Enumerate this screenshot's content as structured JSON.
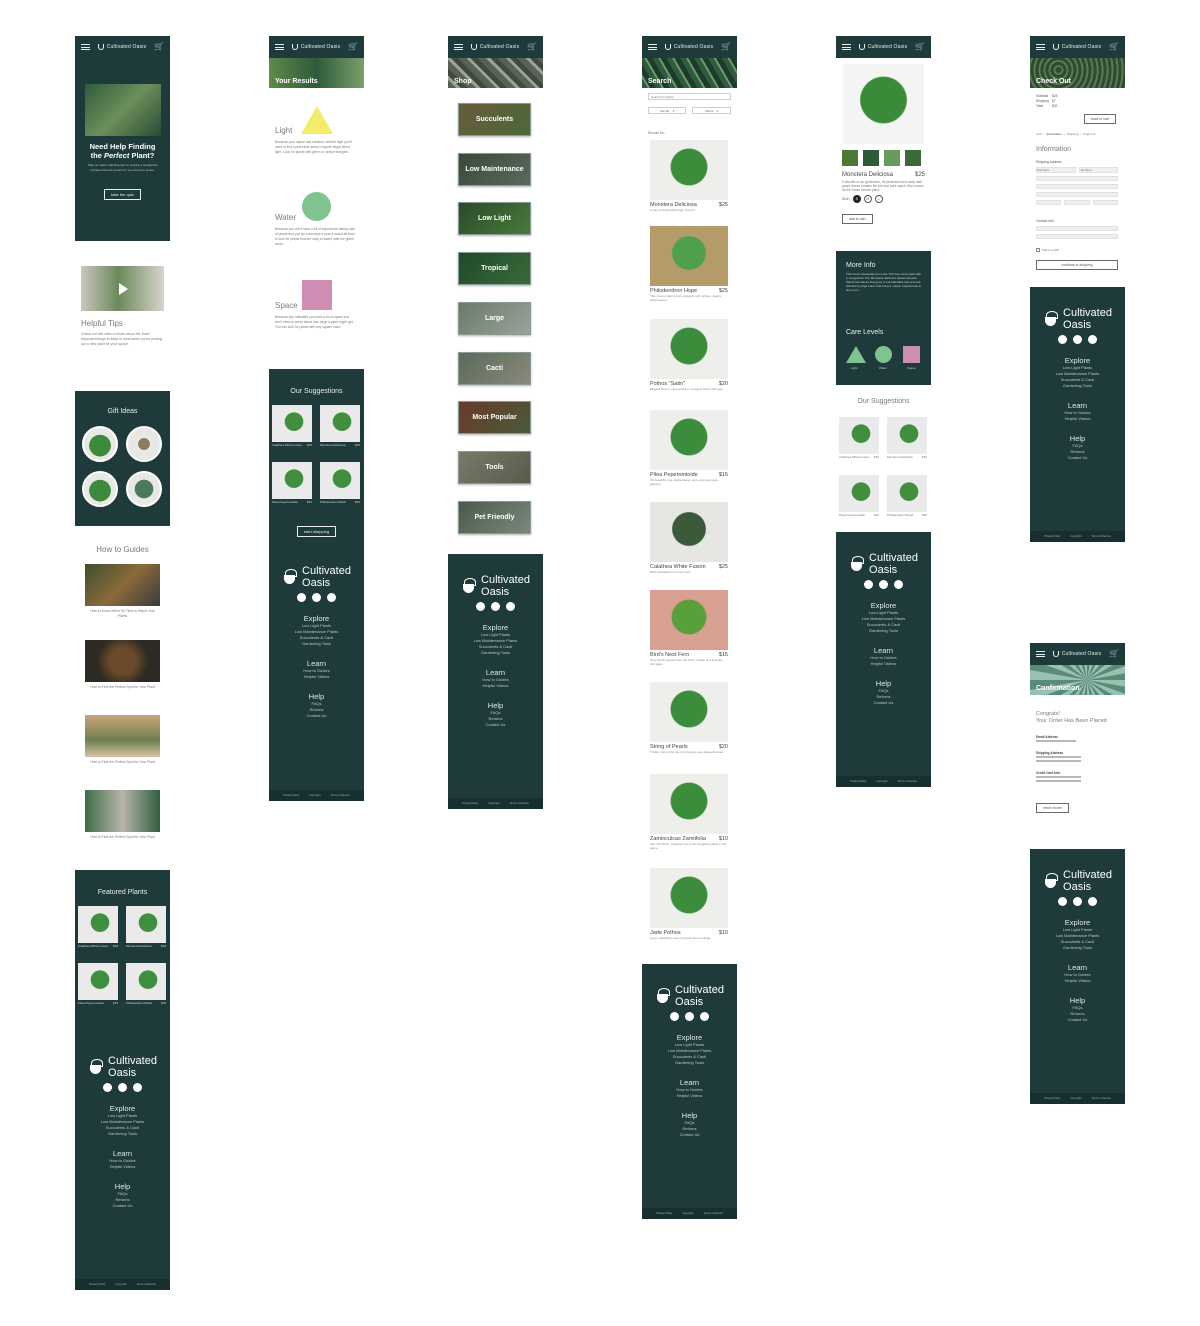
{
  "brand": {
    "name": "Cultivated Oasis",
    "line1": "Cultivated",
    "line2": "Oasis"
  },
  "colors": {
    "primary": "#1e3a3a",
    "footer_bar": "#17302f",
    "triangle": "#f2ec6a",
    "circle": "#7fc48f",
    "square": "#cf8db3"
  },
  "footer": {
    "explore_heading": "Explore",
    "explore_links": [
      "Low Light Plants",
      "Low Maintenance Plants",
      "Succulents & Cacti",
      "Gardening Tools"
    ],
    "learn_heading": "Learn",
    "learn_links": [
      "How to Guides",
      "Helpful Videos"
    ],
    "help_heading": "Help",
    "help_links": [
      "FAQs",
      "Returns",
      "Contact Us"
    ],
    "bottom": [
      "Privacy Policy",
      "Copyright",
      "Terms of Service"
    ]
  },
  "home": {
    "hero_title_1": "Need Help Finding",
    "hero_title_2_pre": "the ",
    "hero_title_2_em": "Perfect",
    "hero_title_2_post": " Plant?",
    "hero_text": "Take our plant matching quiz to receive a curated list of plants that are perfect for you and your space.",
    "quiz_button": "take the quiz",
    "tips_title": "Helpful Tips",
    "tips_text": "Check out this video to learn about the three important things to keep in mind when you're picking out a new plant for your space.",
    "gift_title": "Gift Ideas",
    "guides_title": "How to Guides",
    "guides": [
      "How to Know When it's Time to Repot Your Plants",
      "How to Find the Perfect Spot for Your Plant",
      "How to Find the Perfect Spot for Your Plant",
      "How to Find the Perfect Spot for Your Plant"
    ],
    "featured_title": "Featured Plants"
  },
  "results": {
    "hero": "Your Results",
    "light_label": "Light",
    "light_text": "Because your space has medium, indirect light you'll want to find a plant that doesn't require bright direct light. Look for plants with green or yellow triangles.",
    "water_label": "Water",
    "water_text": "Because you don't have a lot of experience taking care of plants and you go a few trips a year it would be best to look for plants that are easy to water, with the green circle.",
    "space_label": "Space",
    "space_text": "Because you indicated you have a lot of space you don't need to worry about how large a plant might get. You can look for plants with any square color.",
    "suggestions_title": "Our Suggestions",
    "start_button": "start shopping"
  },
  "cards": [
    {
      "name": "Calathea White Fusion",
      "price": "$25"
    },
    {
      "name": "Monstera Deliciosa",
      "price": "$25"
    },
    {
      "name": "Pilea Peperomioide",
      "price": "$15"
    },
    {
      "name": "Philodendron Brasil",
      "price": "$25"
    }
  ],
  "shop": {
    "hero": "Shop",
    "categories": [
      "Succulents",
      "Low Maintenance",
      "Low Light",
      "Tropical",
      "Large",
      "Cacti",
      "Most Popular",
      "Tools",
      "Pet Friendly"
    ]
  },
  "search": {
    "hero": "Search",
    "placeholder": "Search for plants",
    "sort": "Sort By",
    "filters": "Filters",
    "results_for": "Results for..."
  },
  "plants": [
    {
      "name": "Monstera Deliciosa",
      "price": "$25",
      "desc": "Lively and wild with large, tropical"
    },
    {
      "name": "Philodendron Hope",
      "price": "$25",
      "desc": "This cheery plant grows outwards with unique, deeply lobed leaves."
    },
    {
      "name": "Pothos \"Satin\"",
      "price": "$20",
      "desc": "Elegant charm, easy-growing, and gets better with age."
    },
    {
      "name": "Pilea Peperomioide",
      "price": "$15",
      "desc": "It's beautiful, low-maintenance, and extremely easy-growing."
    },
    {
      "name": "Calathea White Fusion",
      "price": "$25",
      "desc": "Bold variegation on every leaf"
    },
    {
      "name": "Bird's Nest Fern",
      "price": "$15",
      "desc": "New fronds appear from the fuzzy rosette and look like bird eggs."
    },
    {
      "name": "String of Pearls",
      "price": "$20",
      "desc": "Trailing stems that are full of glossy pea-shaped leaves."
    },
    {
      "name": "Zamioculcas Zamiifolia",
      "price": "$10",
      "desc": "Aka \"ZZ Plant\". Arguably one of the toughest plants in the game."
    },
    {
      "name": "Jade Pothos",
      "price": "$10",
      "desc": "Long, cascading vines and jade green foliage."
    }
  ],
  "product": {
    "name": "Monstera Deliciosa",
    "price": "$25",
    "desc": "A favorite of our generation, its perforated and waxy dark green leaves breathe life into any bare space. Also known as the Swiss cheese plant.",
    "size_label": "Size:",
    "sizes": [
      "S",
      "M",
      "L"
    ],
    "add_button": "add to cart",
    "more_title": "More Info",
    "more_text": "This iconic houseplant from the 70's has come back with a vengeance! The Monstera deliciosa (Swiss Cheese Plant) has leaves that grow to considerable size and are defined by large holes that bring a unique tropical look to any room.",
    "care_title": "Care Levels",
    "care_labels": [
      "Light",
      "Water",
      "Space"
    ],
    "suggestions_title": "Our Suggestions"
  },
  "checkout": {
    "hero": "Check Out",
    "subtotal_label": "Subtotal",
    "subtotal": "$25",
    "shipping_label": "Shipping",
    "shipping": "$7",
    "total_label": "Total",
    "total": "$32",
    "back_button": "back to cart",
    "steps": [
      "Cart",
      "Information",
      "Shipping",
      "Payment"
    ],
    "info_title": "Information",
    "shipping_address": "Shipping Address",
    "first_name": "First Name",
    "last_name": "Last Name",
    "contact_info": "Contact Info",
    "gift_label": "This is a Gift",
    "continue_button": "continue to shipping"
  },
  "confirmation": {
    "hero": "Confirmation",
    "line1": "Congrats!",
    "line2": "Your Order Has Been Placed",
    "email_label": "Email Address",
    "shipping_label": "Shipping Address",
    "card_label": "Credit Card Info",
    "return_button": "return home"
  }
}
